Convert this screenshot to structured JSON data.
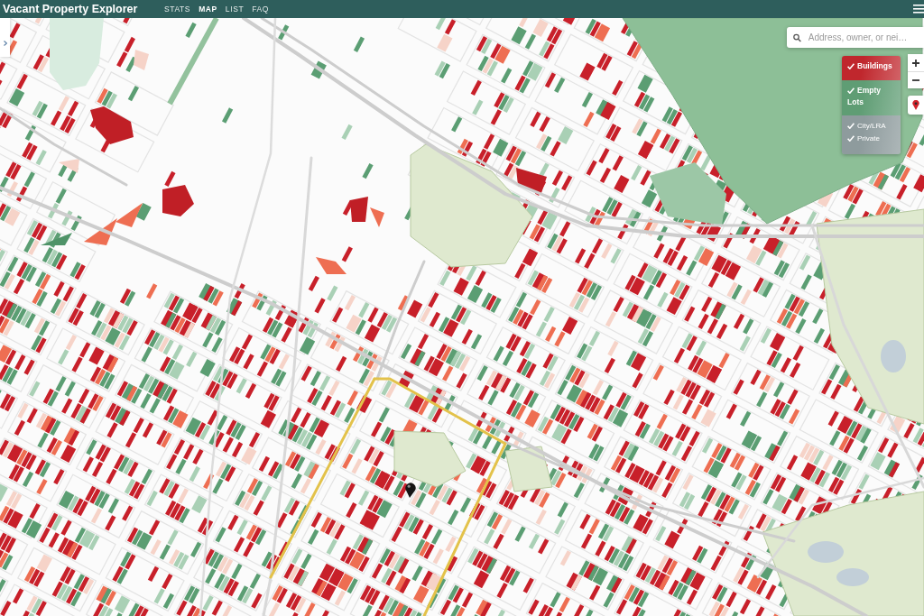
{
  "header": {
    "title": "Vacant Property Explorer",
    "tabs": [
      {
        "label": "STATS",
        "selected": false
      },
      {
        "label": "MAP",
        "selected": true
      },
      {
        "label": "LIST",
        "selected": false
      },
      {
        "label": "FAQ",
        "selected": false
      }
    ]
  },
  "search": {
    "placeholder": "Address, owner, or nei…"
  },
  "legend": [
    {
      "kind": "layer",
      "color": "#c0272d",
      "items": [
        {
          "label": "Buildings",
          "checked": true
        }
      ]
    },
    {
      "kind": "layer",
      "color": "#5f9d74",
      "items": [
        {
          "label": "Empty Lots",
          "checked": true
        }
      ]
    },
    {
      "kind": "owner",
      "color": "#8e9b9d",
      "items": [
        {
          "label": "City/LRA",
          "checked": true
        },
        {
          "label": "Private",
          "checked": true
        }
      ]
    }
  ]
}
